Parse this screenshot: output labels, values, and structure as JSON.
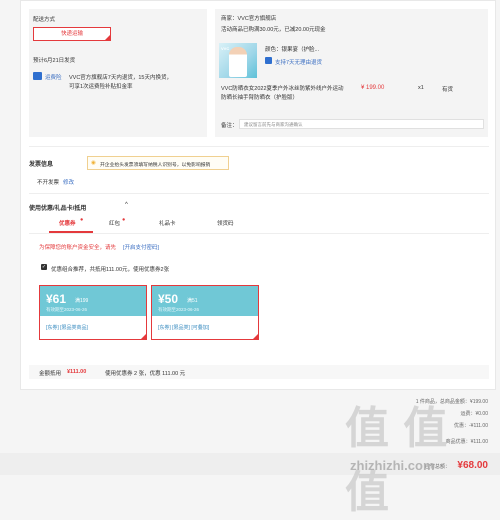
{
  "shipping": {
    "section_label": "配送方式",
    "express_button": "快递运输",
    "arrival": "预计6月21日发货",
    "return_icon": "return-icon",
    "return_label": "运费险",
    "return_desc_1": "VVC官方旗舰店7天内退货，15天内换货，",
    "return_desc_2": "可享1次运费险补贴扣金率"
  },
  "product": {
    "shop": "商家：VVC官方旗舰店",
    "promo": "活动商品已购满30.00元，已减20.00元现金",
    "thumb_text": "VVC",
    "color": "颜色：银果宴（护脸...",
    "support_icon": "shield-icon",
    "support": "支持7天无理由退货",
    "title_1": "VVC防晒衣女2022夏季户外冰丝防紫外线户外运动",
    "title_2": "防晒长袖手臂防晒衣（护脸版）",
    "price": "¥ 199.00",
    "qty": "x1",
    "stock": "有货",
    "remark_label": "备注：",
    "remark_placeholder": "建议留言前先与商家沟通确认"
  },
  "invoice": {
    "title": "发票信息",
    "tip_icon": "lightbulb-icon",
    "tip": "开企业抬头发票须填写纳税人识别号，以免影响报销",
    "status": "不开发票",
    "edit": "修改"
  },
  "coupons": {
    "title": "使用优惠/礼品卡/抵用",
    "toggle_icon": "chevron-up-icon",
    "tabs": [
      "优惠券",
      "红包",
      "礼品卡",
      "领货码"
    ],
    "warning_1": "为保障您的账户资金安全，请先",
    "warning_link": "[开启支付密码]",
    "checkbox_label": "优惠组合推荐，共抵用111.00元，使用优惠券2张",
    "cards": [
      {
        "amount": "¥61",
        "cond": "满199",
        "valid": "有效期至2023-06-26",
        "links": "[东券] [限品类商品]"
      },
      {
        "amount": "¥50",
        "cond": "满51",
        "valid": "有效期至2023-06-26",
        "links": "[东券] [限品类] [可叠加]"
      }
    ],
    "footer_label": "金额抵用",
    "footer_amount": "¥111.00",
    "footer_desc": "使用优惠券 2 张，优惠 111.00 元"
  },
  "summary": {
    "rows": [
      {
        "label": "1 件商品，总商品金额：",
        "value": "¥199.00"
      },
      {
        "label": "运费：",
        "value": "¥0.00"
      },
      {
        "label": "优惠：",
        "value": "-¥111.00"
      },
      {
        "label": "商品优惠：",
        "value": "¥111.00"
      }
    ],
    "payable_label": "应付总额：",
    "payable": "¥68.00"
  },
  "watermark": {
    "big": "值 值 值",
    "url": "zhizhizhi.com"
  }
}
